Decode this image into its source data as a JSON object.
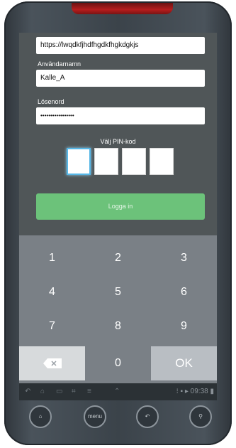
{
  "login": {
    "url_value": "https://lwqdkfjhdfhgdkfhgkdgkjs",
    "username_label": "Användarnamn",
    "username_value": "Kalle_A",
    "password_label": "Lösenord",
    "password_value": "•••••••••••••••••",
    "pin_label": "Välj PIN-kod",
    "login_button": "Logga in"
  },
  "keypad": {
    "keys": [
      "1",
      "2",
      "3",
      "4",
      "5",
      "6",
      "7",
      "8",
      "9",
      "",
      "0",
      "OK"
    ]
  },
  "statusbar": {
    "time": "09:38"
  },
  "hardware_buttons": {
    "menu_label": "menu"
  },
  "colors": {
    "login_button": "#6cc27a",
    "pin_active_border": "#56b6e6",
    "keypad_bg": "#7a8086"
  }
}
